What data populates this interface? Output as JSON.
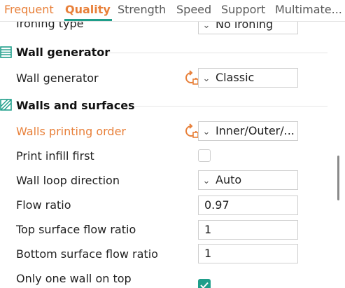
{
  "tabs": [
    {
      "label": "Frequent"
    },
    {
      "label": "Quality"
    },
    {
      "label": "Strength"
    },
    {
      "label": "Speed"
    },
    {
      "label": "Support"
    },
    {
      "label": "Multimate..."
    }
  ],
  "rows": {
    "ironing_type": {
      "label": "Ironing type",
      "value": "No ironing"
    },
    "wall_generator": {
      "label": "Wall generator",
      "value": "Classic"
    },
    "walls_printing_order": {
      "label": "Walls printing order",
      "value": "Inner/Outer/..."
    },
    "print_infill_first": {
      "label": "Print infill first",
      "checked": false
    },
    "wall_loop_direction": {
      "label": "Wall loop direction",
      "value": "Auto"
    },
    "flow_ratio": {
      "label": "Flow ratio",
      "value": "0.97"
    },
    "top_surface_flow_ratio": {
      "label": "Top surface flow ratio",
      "value": "1"
    },
    "bottom_surface_flow_ratio": {
      "label": "Bottom surface flow ratio",
      "value": "1"
    },
    "only_one_wall_on_top": {
      "label": "Only one wall on top",
      "checked": true
    }
  },
  "sections": {
    "wall_generator": {
      "title": "Wall generator",
      "icon": "wall-generator-icon"
    },
    "walls_and_surfaces": {
      "title": "Walls and surfaces",
      "icon": "walls-surfaces-icon"
    }
  },
  "colors": {
    "accent_orange": "#e8803a",
    "accent_teal": "#1f9e8a"
  }
}
